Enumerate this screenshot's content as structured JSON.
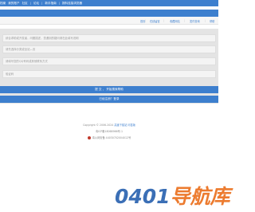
{
  "topnav": {
    "items": [
      "档案",
      "我的账户",
      "社区",
      "论坛",
      "新手指南",
      "报料连接浏览器"
    ]
  },
  "subnav": {
    "items": [
      "首页",
      "在线留言",
      "收藏网站",
      "发件查询",
      "帮助"
    ]
  },
  "form": {
    "fields": [
      "综合求助或开发者，问题描述，您遇到的疑问请在此填写说明",
      "请先选择分类或全站—页",
      "请填写您的QQ号码或其他联系方式",
      "验证码"
    ],
    "submit_label": "提 交 ， 开始搜索帮助",
    "secondary_label": "已经注册？登录"
  },
  "footer": {
    "copyright": "Copyright © 2006-2024",
    "link1": "高速下载站",
    "link2": "问答版",
    "icp": "粤ICP备18068966号-1",
    "police": "粤公网安备 44030702004012号"
  },
  "watermark": {
    "number": "0401",
    "text": "导航库"
  },
  "colors": {
    "primary": "#3d7fce",
    "form_bg": "#e4e4e4",
    "watermark_blue": "#3b6fb6",
    "watermark_orange": "#ec7b2f"
  }
}
